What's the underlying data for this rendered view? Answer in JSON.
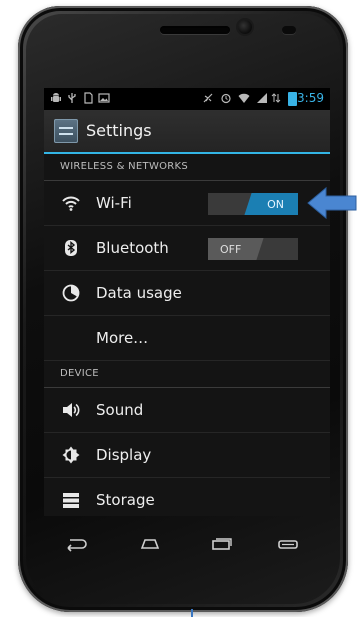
{
  "status_bar": {
    "time": "3:59"
  },
  "action_bar": {
    "title": "Settings"
  },
  "sections": {
    "wireless": {
      "label": "WIRELESS & NETWORKS"
    },
    "device": {
      "label": "DEVICE"
    }
  },
  "items": {
    "wifi": {
      "label": "Wi-Fi",
      "toggle": "ON",
      "icon": "wifi-icon"
    },
    "bluetooth": {
      "label": "Bluetooth",
      "toggle": "OFF",
      "icon": "bluetooth-icon"
    },
    "data_usage": {
      "label": "Data usage",
      "icon": "data-usage-icon"
    },
    "more": {
      "label": "More…"
    },
    "sound": {
      "label": "Sound",
      "icon": "speaker-icon"
    },
    "display": {
      "label": "Display",
      "icon": "display-icon"
    },
    "storage": {
      "label": "Storage",
      "icon": "storage-icon"
    }
  },
  "colors": {
    "accent": "#33b5e5",
    "toggle_on": "#1b7fb3",
    "annotation_arrow": "#4a86d1"
  }
}
